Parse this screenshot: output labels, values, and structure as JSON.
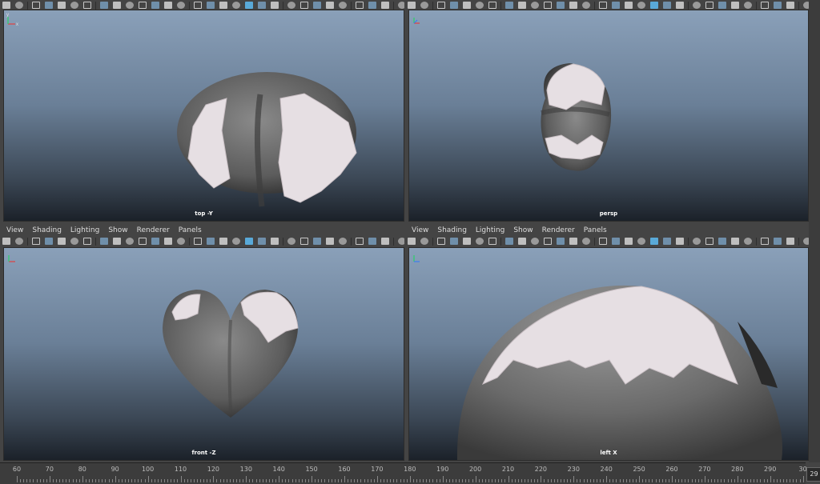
{
  "panel_menu": [
    "View",
    "Shading",
    "Lighting",
    "Show",
    "Renderer",
    "Panels"
  ],
  "panels": [
    {
      "label": "top -Y"
    },
    {
      "label": "persp"
    },
    {
      "label": "front -Z"
    },
    {
      "label": "left X"
    }
  ],
  "toolbar_icons": [
    "select-camera-icon",
    "camera-attributes-icon",
    "bookmark-icon",
    "image-plane-icon",
    "grease-pencil-icon",
    "isolate-icon",
    "2d-pan-zoom-icon",
    "grid-icon",
    "film-gate-icon",
    "resolution-gate-icon",
    "gate-mask-icon",
    "field-chart-icon",
    "safe-action-icon",
    "safe-title-icon",
    "wireframe-icon",
    "smooth-shade-icon",
    "use-default-material-icon",
    "wireframe-on-shaded-icon",
    "textured-icon",
    "all-lights-icon",
    "shadows-icon",
    "screen-space-ao-icon",
    "motion-blur-icon",
    "multisample-aa-icon",
    "depth-of-field-icon",
    "isolate-select-icon",
    "xray-icon",
    "xray-joints-icon",
    "xray-components-icon",
    "hdr-icon",
    "exposure-icon",
    "gamma-icon",
    "color-management-icon"
  ],
  "axis_labels": {
    "y": "y",
    "x": "x",
    "z": "z"
  },
  "timeline": {
    "ticks": [
      "60",
      "70",
      "80",
      "90",
      "100",
      "110",
      "120",
      "130",
      "140",
      "150",
      "160",
      "170",
      "180",
      "190",
      "200",
      "210",
      "220",
      "230",
      "240",
      "250",
      "260",
      "270",
      "280",
      "290",
      "30"
    ],
    "current_frame": "29"
  },
  "colors": {
    "active_icon": "#59a9d8",
    "model_gray": "#6e6e6e",
    "shell_pink": "#e6dfe3",
    "viewport_top": "#8aa0b9",
    "viewport_bottom": "#1b2129"
  }
}
